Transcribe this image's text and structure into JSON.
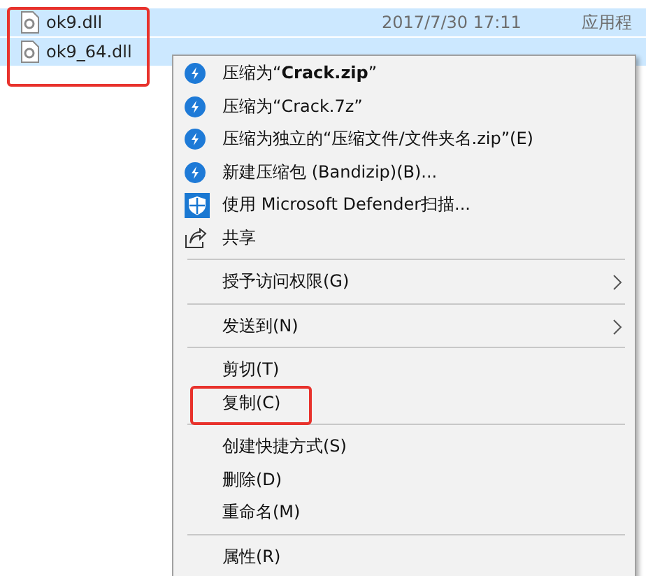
{
  "files": {
    "highlighted": true,
    "rows": [
      {
        "name": "ok9.dll",
        "date": "2017/7/30 17:11",
        "type": "应用程",
        "selected": true
      },
      {
        "name": "ok9_64.dll",
        "selected": true
      }
    ]
  },
  "menu": {
    "items": [
      {
        "kind": "compress",
        "label": "压缩为“**Crack.zip**”",
        "highlighted": false
      },
      {
        "kind": "compress",
        "label": "压缩为“Crack.7z”",
        "highlighted": false
      },
      {
        "kind": "compress",
        "label": "压缩为独立的“压缩文件/文件夹名.zip”(E)",
        "highlighted": false
      },
      {
        "kind": "compress",
        "label": "新建压缩包 (Bandizip)(B)...",
        "highlighted": false
      },
      {
        "kind": "scan",
        "label": "使用 Microsoft Defender扫描...",
        "highlighted": false
      },
      {
        "kind": "share",
        "label": "共享",
        "highlighted": false
      },
      {
        "kind": "separator"
      },
      {
        "kind": "submenu",
        "label": "授予访问权限(G)",
        "highlighted": false
      },
      {
        "kind": "separator"
      },
      {
        "kind": "submenu",
        "label": "发送到(N)",
        "highlighted": false
      },
      {
        "kind": "separator"
      },
      {
        "kind": "plain",
        "label": "剪切(T)",
        "highlighted": false
      },
      {
        "kind": "plain",
        "label": "复制(C)",
        "highlighted": true
      },
      {
        "kind": "separator"
      },
      {
        "kind": "plain",
        "label": "创建快捷方式(S)",
        "highlighted": false
      },
      {
        "kind": "plain",
        "label": "删除(D)",
        "highlighted": false
      },
      {
        "kind": "plain",
        "label": "重命名(M)",
        "highlighted": false
      },
      {
        "kind": "separator"
      },
      {
        "kind": "plain",
        "label": "属性(R)",
        "highlighted": false
      }
    ]
  }
}
